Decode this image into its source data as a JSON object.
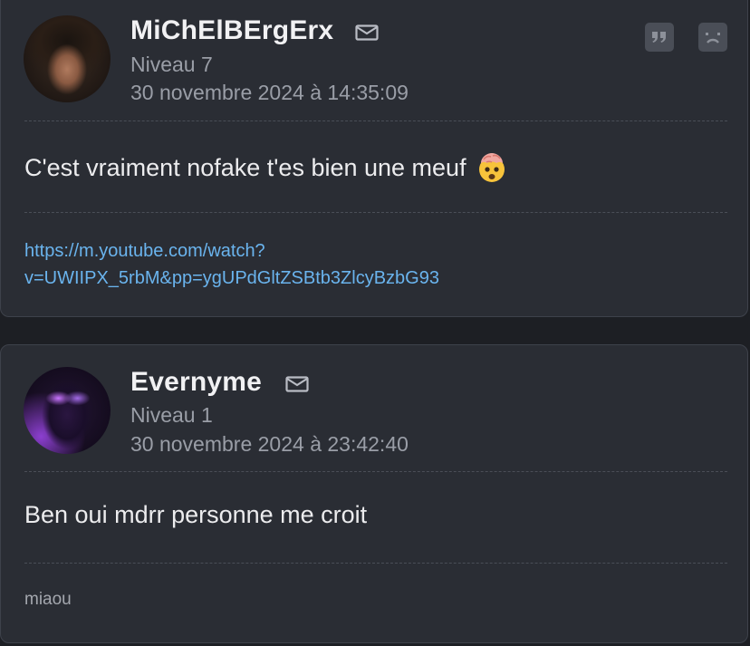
{
  "posts": [
    {
      "username": "MiChElBErgErx",
      "level": "Niveau 7",
      "date": "30 novembre 2024 à 14:35:09",
      "message": "C'est vraiment nofake t'es bien une meuf",
      "emoji": "exploding-head-emoji",
      "signature_link_line1": "https://m.youtube.com/watch?",
      "signature_link_line2": "v=UWIIPX_5rbM&pp=ygUPdGltZSBtb3ZlcyBzbG93",
      "actions": [
        "quote-icon",
        "sad-face-icon"
      ]
    },
    {
      "username": "Evernyme",
      "level": "Niveau 1",
      "date": "30 novembre 2024 à 23:42:40",
      "message": "Ben oui mdrr personne me croit",
      "signature_text": "miaou"
    }
  ],
  "colors": {
    "background": "#1d1f24",
    "card": "#2a2d34",
    "username": "#f1f1f3",
    "meta": "#9a9ea7",
    "link": "#6ab4ee"
  }
}
